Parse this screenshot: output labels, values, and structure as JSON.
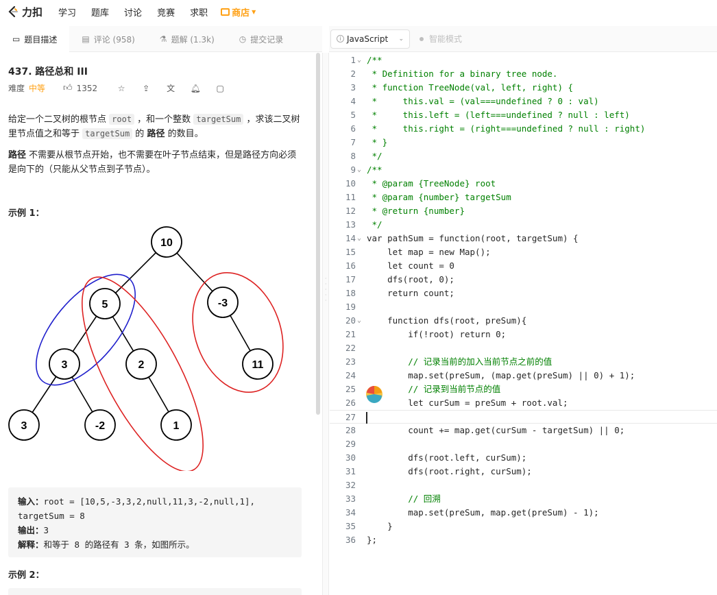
{
  "nav": {
    "logo_text": "力扣",
    "items": [
      "学习",
      "题库",
      "讨论",
      "竞赛",
      "求职"
    ],
    "store": "商店"
  },
  "tabs": {
    "description": "题目描述",
    "comments": "评论 (958)",
    "solutions": "题解 (1.3k)",
    "submissions": "提交记录"
  },
  "editor_bar": {
    "language": "JavaScript",
    "smart_mode": "智能模式"
  },
  "problem": {
    "title": "437. 路径总和 III",
    "difficulty_label": "难度",
    "difficulty": "中等",
    "likes": "1352",
    "desc1_a": "给定一个二叉树的根节点 ",
    "desc1_root": "root",
    "desc1_b": " ，和一个整数 ",
    "desc1_target": "targetSum",
    "desc1_c": " ，求该二叉树里节点值之和等于 ",
    "desc1_target2": "targetSum",
    "desc1_d": " 的 ",
    "desc1_bold": "路径",
    "desc1_e": " 的数目。",
    "desc2_bold": "路径",
    "desc2_text": " 不需要从根节点开始，也不需要在叶子节点结束，但是路径方向必须是向下的（只能从父节点到子节点）。",
    "example1_title": "示例 1：",
    "example2_title": "示例 2：",
    "example1": {
      "input_label": "输入：",
      "input_value": "root = [10,5,-3,3,2,null,11,3,-2,null,1],",
      "input_value2": "targetSum = 8",
      "output_label": "输出：",
      "output_value": "3",
      "explain_label": "解释：",
      "explain_value": "和等于 8 的路径有 3 条，如图所示。"
    }
  },
  "tree": {
    "nodes": [
      "10",
      "5",
      "-3",
      "3",
      "2",
      "11",
      "3",
      "-2",
      "1"
    ],
    "colors": {
      "blue": "#1f1fcc",
      "red": "#dd2222"
    }
  },
  "code_lines": [
    "/**",
    " * Definition for a binary tree node.",
    " * function TreeNode(val, left, right) {",
    " *     this.val = (val===undefined ? 0 : val)",
    " *     this.left = (left===undefined ? null : left)",
    " *     this.right = (right===undefined ? null : right)",
    " * }",
    " */",
    "/**",
    " * @param {TreeNode} root",
    " * @param {number} targetSum",
    " * @return {number}",
    " */",
    "var pathSum = function(root, targetSum) {",
    "    let map = new Map();",
    "    let count = 0",
    "    dfs(root, 0);",
    "    return count;",
    "",
    "    function dfs(root, preSum){",
    "        if(!root) return 0;",
    "",
    "        // 记录当前的加入当前节点之前的值",
    "        map.set(preSum, (map.get(preSum) || 0) + 1);",
    "        // 记录到当前节点的值",
    "        let curSum = preSum + root.val;",
    "",
    "        count += map.get(curSum - targetSum) || 0;",
    "",
    "        dfs(root.left, curSum);",
    "        dfs(root.right, curSum);",
    "",
    "        // 回溯",
    "        map.set(preSum, map.get(preSum) - 1);",
    "    }",
    "};"
  ],
  "line_numbers": [
    "1",
    "2",
    "3",
    "4",
    "5",
    "6",
    "7",
    "8",
    "9",
    "10",
    "11",
    "12",
    "13",
    "14",
    "15",
    "16",
    "17",
    "18",
    "19",
    "20",
    "21",
    "22",
    "23",
    "24",
    "25",
    "26",
    "27",
    "28",
    "29",
    "30",
    "31",
    "32",
    "33",
    "34",
    "35",
    "36"
  ],
  "colors": {
    "accent": "#ffa116",
    "comment": "#008000",
    "keyword": "#770088"
  }
}
